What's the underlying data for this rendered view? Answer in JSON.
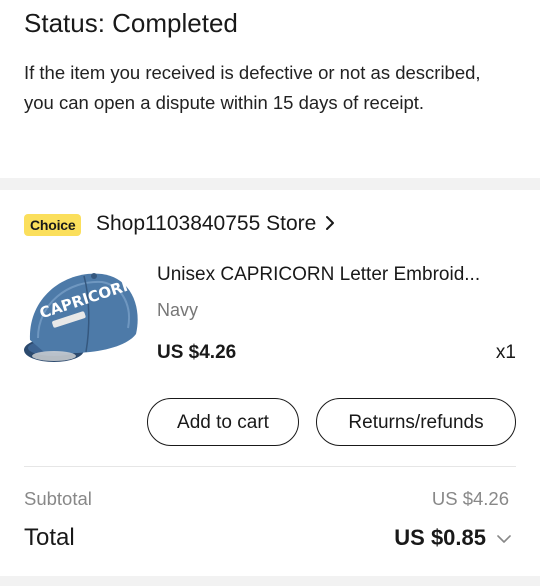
{
  "status": {
    "title": "Status: Completed",
    "description": "If the item you received is defective or not as described, you can open a dispute within 15 days of receipt."
  },
  "store": {
    "badge": "Choice",
    "name": "Shop1103840755 Store",
    "chevron_icon": "chevron-right-icon"
  },
  "product": {
    "image_icon": "denim-cap-product-image",
    "image_text": "CAPRICORN",
    "title": "Unisex CAPRICORN Letter Embroid...",
    "variant": "Navy",
    "price": "US $4.26",
    "quantity": "x1"
  },
  "actions": {
    "add_to_cart": "Add to cart",
    "returns": "Returns/refunds"
  },
  "summary": {
    "subtotal_label": "Subtotal",
    "subtotal_value": "US $4.26",
    "total_label": "Total",
    "total_value": "US $0.85",
    "expand_icon": "chevron-down-icon"
  },
  "colors": {
    "choice_badge": "#fbdf5c",
    "background_band": "#f2f2f2",
    "text_primary": "#191919",
    "text_muted": "#888888"
  }
}
